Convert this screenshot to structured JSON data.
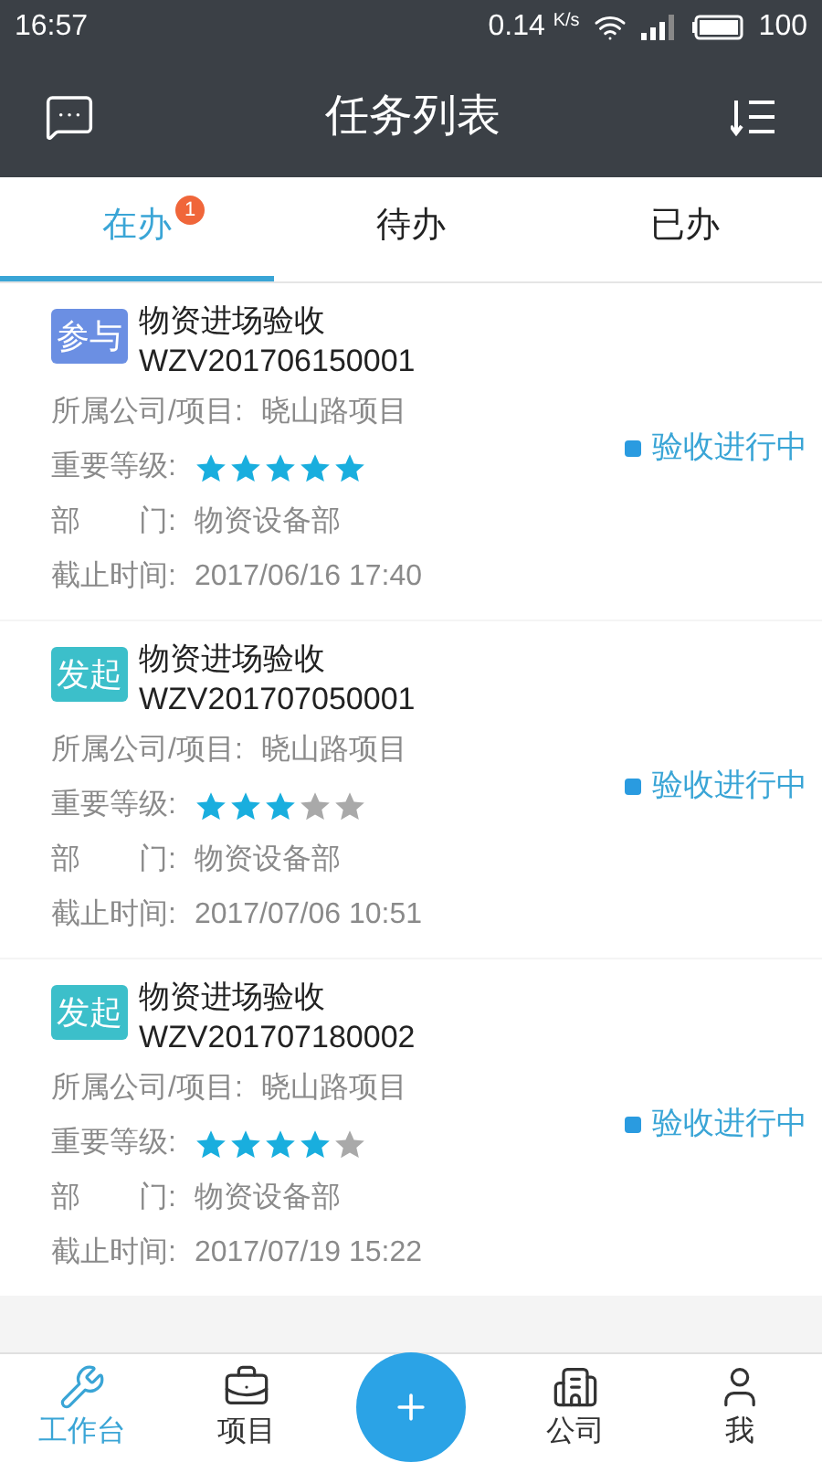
{
  "status_bar": {
    "time": "16:57",
    "speed": "0.14",
    "speed_unit": "K/s",
    "battery": "100"
  },
  "header": {
    "title": "任务列表"
  },
  "tabs": [
    {
      "label": "在办",
      "selected": true,
      "badge": "1"
    },
    {
      "label": "待办",
      "selected": false
    },
    {
      "label": "已办",
      "selected": false
    }
  ],
  "tasks": [
    {
      "tag": "参与",
      "color": "#6b8fe3",
      "title": "物资进场验收",
      "code": "WZV201706150001",
      "fields": [
        {
          "label": "所属公司/项目:",
          "value": "晓山路项目"
        },
        {
          "label": "重要等级:",
          "stars": 5
        },
        {
          "label": "部　　门:",
          "value": "物资设备部"
        },
        {
          "label": "截止时间:",
          "value": "2017/06/16 17:40"
        }
      ],
      "status": "验收进行中"
    },
    {
      "tag": "发起",
      "color": "#3cbfca",
      "title": "物资进场验收",
      "code": "WZV201707050001",
      "fields": [
        {
          "label": "所属公司/项目:",
          "value": "晓山路项目"
        },
        {
          "label": "重要等级:",
          "stars": 3
        },
        {
          "label": "部　　门:",
          "value": "物资设备部"
        },
        {
          "label": "截止时间:",
          "value": "2017/07/06 10:51"
        }
      ],
      "status": "验收进行中"
    },
    {
      "tag": "发起",
      "color": "#3cbfca",
      "title": "物资进场验收",
      "code": "WZV201707180002",
      "fields": [
        {
          "label": "所属公司/项目:",
          "value": "晓山路项目"
        },
        {
          "label": "重要等级:",
          "stars": 4
        },
        {
          "label": "部　　门:",
          "value": "物资设备部"
        },
        {
          "label": "截止时间:",
          "value": "2017/07/19 15:22"
        }
      ],
      "status": "验收进行中"
    }
  ],
  "nav": [
    {
      "kind": "workbench",
      "label": "工作台",
      "selected": true
    },
    {
      "kind": "project",
      "label": "项目",
      "selected": false
    },
    {
      "kind": "add"
    },
    {
      "kind": "company",
      "label": "公司",
      "selected": false
    },
    {
      "kind": "me",
      "label": "我",
      "selected": false
    }
  ]
}
